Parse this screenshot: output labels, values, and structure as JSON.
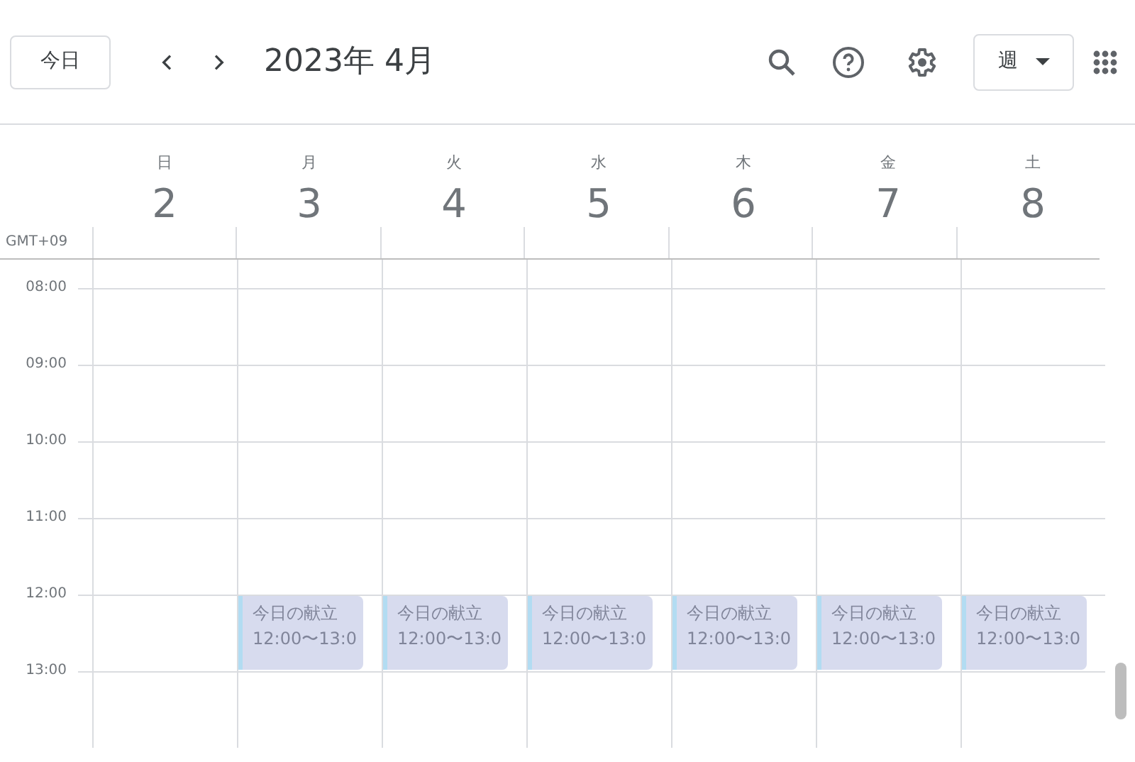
{
  "toolbar": {
    "today_button": "今日",
    "title": "2023年 4月",
    "view_button": "週"
  },
  "timezone": "GMT+09",
  "hours": [
    "08:00",
    "09:00",
    "10:00",
    "11:00",
    "12:00",
    "13:00"
  ],
  "days": [
    {
      "weekday": "日",
      "date": "2"
    },
    {
      "weekday": "月",
      "date": "3",
      "events": [
        {
          "title": "今日の献立",
          "time": "12:00〜13:0"
        }
      ]
    },
    {
      "weekday": "火",
      "date": "4",
      "events": [
        {
          "title": "今日の献立",
          "time": "12:00〜13:0"
        }
      ]
    },
    {
      "weekday": "水",
      "date": "5",
      "events": [
        {
          "title": "今日の献立",
          "time": "12:00〜13:0"
        }
      ]
    },
    {
      "weekday": "木",
      "date": "6",
      "events": [
        {
          "title": "今日の献立",
          "time": "12:00〜13:0"
        }
      ]
    },
    {
      "weekday": "金",
      "date": "7",
      "events": [
        {
          "title": "今日の献立",
          "time": "12:00〜13:0"
        }
      ]
    },
    {
      "weekday": "土",
      "date": "8",
      "events": [
        {
          "title": "今日の献立",
          "time": "12:00〜13:0"
        }
      ]
    }
  ]
}
